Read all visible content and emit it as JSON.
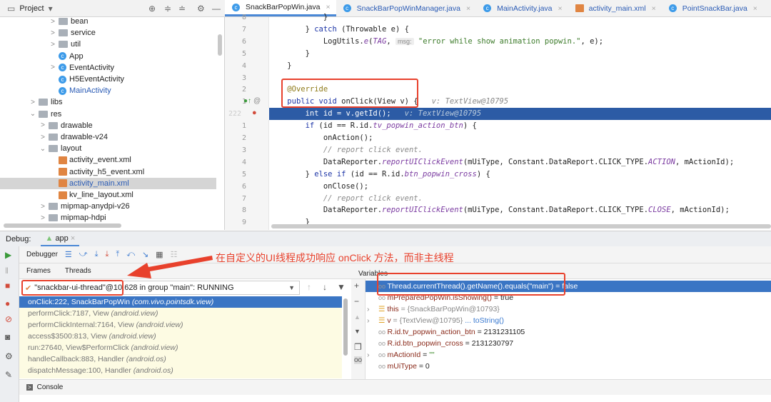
{
  "project": {
    "title": "Project",
    "tree": [
      {
        "label": "bean",
        "type": "folder",
        "indent": 3,
        "chev": ">"
      },
      {
        "label": "service",
        "type": "folder",
        "indent": 3,
        "chev": ">"
      },
      {
        "label": "util",
        "type": "folder",
        "indent": 3,
        "chev": ">"
      },
      {
        "label": "App",
        "type": "class",
        "indent": 3,
        "chev": ""
      },
      {
        "label": "EventActivity",
        "type": "class",
        "indent": 3,
        "chev": ">"
      },
      {
        "label": "H5EventActivity",
        "type": "class",
        "indent": 3,
        "chev": ""
      },
      {
        "label": "MainActivity",
        "type": "class",
        "indent": 3,
        "chev": "",
        "blue": true
      },
      {
        "label": "libs",
        "type": "folder",
        "indent": 1,
        "chev": ">"
      },
      {
        "label": "res",
        "type": "folder",
        "indent": 1,
        "chev": "v"
      },
      {
        "label": "drawable",
        "type": "folder",
        "indent": 2,
        "chev": ">"
      },
      {
        "label": "drawable-v24",
        "type": "folder",
        "indent": 2,
        "chev": ">"
      },
      {
        "label": "layout",
        "type": "folder",
        "indent": 2,
        "chev": "v"
      },
      {
        "label": "activity_event.xml",
        "type": "xml",
        "indent": 3,
        "chev": ""
      },
      {
        "label": "activity_h5_event.xml",
        "type": "xml",
        "indent": 3,
        "chev": ""
      },
      {
        "label": "activity_main.xml",
        "type": "xml",
        "indent": 3,
        "chev": "",
        "selected": true,
        "blue": true
      },
      {
        "label": "kv_line_layout.xml",
        "type": "xml",
        "indent": 3,
        "chev": ""
      },
      {
        "label": "mipmap-anydpi-v26",
        "type": "folder",
        "indent": 2,
        "chev": ">"
      },
      {
        "label": "mipmap-hdpi",
        "type": "folder",
        "indent": 2,
        "chev": ">"
      }
    ]
  },
  "tabs": [
    {
      "label": "SnackBarPopWin.java",
      "active": true
    },
    {
      "label": "SnackBarPopWinManager.java"
    },
    {
      "label": "MainActivity.java"
    },
    {
      "label": "activity_main.xml"
    },
    {
      "label": "PointSnackBar.java"
    }
  ],
  "code": [
    {
      "ln": "8",
      "t": [
        [
          "            }",
          ""
        ]
      ]
    },
    {
      "ln": "7",
      "t": [
        [
          "        } ",
          ""
        ],
        [
          "catch",
          "kw"
        ],
        [
          " (Throwable e) {",
          ""
        ]
      ]
    },
    {
      "ln": "6",
      "t": [
        [
          "            LogUtils.",
          ""
        ],
        [
          "e",
          "it"
        ],
        [
          "(",
          ""
        ],
        [
          "TAG",
          "it"
        ],
        [
          ", ",
          ""
        ],
        [
          "msg:",
          "chip"
        ],
        [
          " ",
          ""
        ],
        [
          "\"error while show animation popwin.\"",
          "str"
        ],
        [
          ", e);",
          ""
        ]
      ]
    },
    {
      "ln": "5",
      "t": [
        [
          "        }",
          ""
        ]
      ]
    },
    {
      "ln": "4",
      "t": [
        [
          "    }",
          ""
        ]
      ]
    },
    {
      "ln": "3",
      "t": [
        [
          "",
          ""
        ]
      ]
    },
    {
      "ln": "2",
      "t": [
        [
          "    ",
          ""
        ],
        [
          "@Override",
          "an"
        ]
      ]
    },
    {
      "ln": "1",
      "t": [
        [
          "    ",
          ""
        ],
        [
          "public void",
          "kw"
        ],
        [
          " onClick(View v) {   ",
          ""
        ],
        [
          "v: TextView@10795",
          "hint"
        ]
      ]
    },
    {
      "ln": "222",
      "hl": true,
      "t": [
        [
          "        ",
          ""
        ],
        [
          "int",
          "kw"
        ],
        [
          " id = v.getId();   ",
          ""
        ],
        [
          "v: TextView@10795",
          "hint"
        ]
      ]
    },
    {
      "ln": "1",
      "t": [
        [
          "        ",
          ""
        ],
        [
          "if",
          "kw"
        ],
        [
          " (id == R.id.",
          ""
        ],
        [
          "tv_popwin_action_btn",
          "it"
        ],
        [
          ") {",
          ""
        ]
      ]
    },
    {
      "ln": "2",
      "t": [
        [
          "            onAction();",
          ""
        ]
      ]
    },
    {
      "ln": "3",
      "t": [
        [
          "            ",
          ""
        ],
        [
          "// report click event.",
          "cm"
        ]
      ]
    },
    {
      "ln": "4",
      "t": [
        [
          "            DataReporter.",
          ""
        ],
        [
          "reportUIClickEvent",
          "it"
        ],
        [
          "(mUiType, Constant.DataReport.CLICK_TYPE.",
          ""
        ],
        [
          "ACTION",
          "it"
        ],
        [
          ", mActionId);",
          ""
        ]
      ]
    },
    {
      "ln": "5",
      "t": [
        [
          "        } ",
          ""
        ],
        [
          "else if",
          "kw"
        ],
        [
          " (id == R.id.",
          ""
        ],
        [
          "btn_popwin_cross",
          "it"
        ],
        [
          ") {",
          ""
        ]
      ]
    },
    {
      "ln": "6",
      "t": [
        [
          "            onClose();",
          ""
        ]
      ]
    },
    {
      "ln": "7",
      "t": [
        [
          "            ",
          ""
        ],
        [
          "// report click event.",
          "cm"
        ]
      ]
    },
    {
      "ln": "8",
      "t": [
        [
          "            DataReporter.",
          ""
        ],
        [
          "reportUIClickEvent",
          "it"
        ],
        [
          "(mUiType, Constant.DataReport.CLICK_TYPE.",
          ""
        ],
        [
          "CLOSE",
          "it"
        ],
        [
          ", mActionId);",
          ""
        ]
      ]
    },
    {
      "ln": "9",
      "t": [
        [
          "        }",
          ""
        ]
      ]
    }
  ],
  "debug": {
    "label": "Debug:",
    "tab": "app",
    "debugger": "Debugger",
    "frames_tab": "Frames",
    "threads_tab": "Threads",
    "variables_tab": "Variables",
    "console": "Console",
    "thread": "\"snackbar-ui-thread\"@10,628 in group \"main\": RUNNING",
    "frames": [
      {
        "m": "onClick:222, SnackBarPopWin",
        "p": "(com.vivo.pointsdk.view)",
        "sel": true
      },
      {
        "m": "performClick:7187, View",
        "p": "(android.view)"
      },
      {
        "m": "performClickInternal:7164, View",
        "p": "(android.view)"
      },
      {
        "m": "access$3500:813, View",
        "p": "(android.view)"
      },
      {
        "m": "run:27640, View$PerformClick",
        "p": "(android.view)"
      },
      {
        "m": "handleCallback:883, Handler",
        "p": "(android.os)"
      },
      {
        "m": "dispatchMessage:100, Handler",
        "p": "(android.os)"
      }
    ],
    "variables": [
      {
        "n": "Thread.currentThread().getName().equals(\"main\")",
        "v": "= false",
        "kind": "watch",
        "sel": true
      },
      {
        "n": "mPreparedPopWin.isShowing()",
        "v": "= true",
        "kind": "watch"
      },
      {
        "n": "this",
        "v": "= {SnackBarPopWin@10793}",
        "kind": "field",
        "exp": true
      },
      {
        "n": "v",
        "v": "= {TextView@10795}",
        "extra": "... toString()",
        "kind": "field",
        "exp": true
      },
      {
        "n": "R.id.tv_popwin_action_btn",
        "v": "= 2131231105",
        "kind": "watch"
      },
      {
        "n": "R.id.btn_popwin_cross",
        "v": "= 2131230797",
        "kind": "watch"
      },
      {
        "n": "mActionId",
        "v": "= ",
        "str": "\"\"",
        "kind": "watch",
        "exp": true
      },
      {
        "n": "mUiType",
        "v": "= 0",
        "kind": "watch"
      }
    ]
  },
  "annotation": {
    "text": "在自定义的UI线程成功响应 onClick 方法，而非主线程",
    "color": "#e8412c"
  }
}
